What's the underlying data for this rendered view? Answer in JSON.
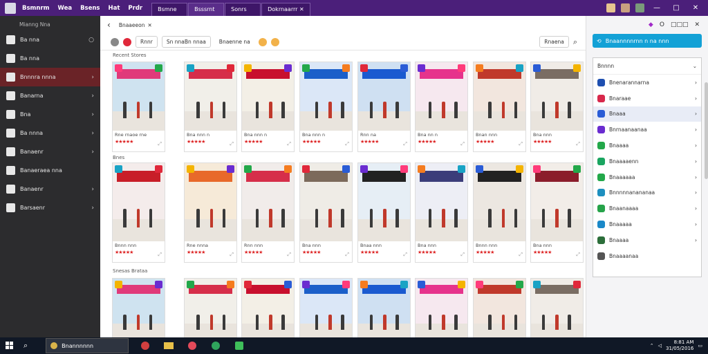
{
  "titlebar": {
    "menu": [
      "Bsmnrm",
      "Wea",
      "Bsens",
      "Hat",
      "Prdr"
    ],
    "tabs": [
      "Bsmne",
      "Bsssrnt",
      "Sonrs",
      "Dokrnaarrr ✕"
    ],
    "window_controls": {
      "minimize": "—",
      "maximize": "□",
      "close": "✕"
    }
  },
  "sidebar": {
    "header": "Mianng Nna",
    "items": [
      {
        "label": "Ba nna",
        "trail": "○",
        "icon": "folder-icon"
      },
      {
        "label": "Ba nna",
        "trail": "",
        "icon": "grid-icon"
      },
      {
        "label": "Bnnnra nnna",
        "trail": "›",
        "icon": "store-icon",
        "active": true
      },
      {
        "label": "Banarna",
        "trail": "›",
        "icon": "home-icon"
      },
      {
        "label": "Bna",
        "trail": "›",
        "icon": "document-icon"
      },
      {
        "label": "Ba nnna",
        "trail": "›",
        "icon": "gallery-icon"
      },
      {
        "label": "Banaenr",
        "trail": "›",
        "icon": "image-icon"
      },
      {
        "label": "Banaeraea nna",
        "trail": "",
        "icon": "settings-icon"
      },
      {
        "label": "Banaenr",
        "trail": "›",
        "icon": "chart-icon"
      },
      {
        "label": "Barsaenr",
        "trail": "›",
        "icon": "user-icon"
      }
    ]
  },
  "toolbar": {
    "back": "‹",
    "crumb": "Bnaaeeon",
    "close": "✕",
    "right_icons": [
      "◆",
      "O",
      "□□□",
      "✕"
    ]
  },
  "filters": {
    "chip1": "Rnnr",
    "chip2": "Sn nnaBn nnaa",
    "chip3": "Bnaenne na",
    "action_button": "Rnaena",
    "search_icon": "search-icon"
  },
  "sections": [
    "Recent Stores",
    "Bnes",
    "Snesas Brataa"
  ],
  "cards": [
    {
      "caption": "Rne rnaoe rne",
      "stars": "★★★★★"
    },
    {
      "caption": "Bna nnn n",
      "stars": "★★★★★"
    },
    {
      "caption": "Bna nnn n",
      "stars": "★★★★★"
    },
    {
      "caption": "Bna nnn n",
      "stars": "★★★★★"
    },
    {
      "caption": "Rnn na",
      "stars": "★★★★★"
    },
    {
      "caption": "Bna nn n",
      "stars": "★★★★★"
    },
    {
      "caption": "Bnan nnn",
      "stars": "★★★★★"
    },
    {
      "caption": "Bna nnn",
      "stars": "★★★★★"
    },
    {
      "caption": "Bnnn nnn",
      "stars": "★★★★★"
    },
    {
      "caption": "Rne nnna",
      "stars": "★★★★★"
    },
    {
      "caption": "Rnn nnn",
      "stars": "★★★★★"
    },
    {
      "caption": "Bna nnn",
      "stars": "★★★★★"
    },
    {
      "caption": "Bnaa nnn",
      "stars": "★★★★★"
    },
    {
      "caption": "Bna nnn",
      "stars": "★★★★★"
    },
    {
      "caption": "Bnnn nnn",
      "stars": "★★★★★"
    },
    {
      "caption": "Bna nnn",
      "stars": "★★★★★"
    }
  ],
  "right_panel": {
    "button": "Bnaannnnrnn n na nnn",
    "list_header": "Bnnnn",
    "items": [
      {
        "label": "Bnenarannarna",
        "trail": "›",
        "color": "#1e4fb0"
      },
      {
        "label": "Bnaraae",
        "trail": "›",
        "color": "#d8284b"
      },
      {
        "label": "Bnaaa",
        "trail": "›",
        "color": "#2a5cd6",
        "active": true
      },
      {
        "label": "Bnrnaanaanaa",
        "trail": "›",
        "color": "#6a2cd0"
      },
      {
        "label": "Bnaaaa",
        "trail": "›",
        "color": "#23a84a"
      },
      {
        "label": "Bnaaaaenn",
        "trail": "›",
        "color": "#1aa560"
      },
      {
        "label": "Bnaaaaaa",
        "trail": "›",
        "color": "#23a84a"
      },
      {
        "label": "Bnnnnnanananaa",
        "trail": "›",
        "color": "#1d8fbf"
      },
      {
        "label": "Bnaanaaaa",
        "trail": "›",
        "color": "#26a34a"
      },
      {
        "label": "Bnaaaaa",
        "trail": "›",
        "color": "#1a88c8"
      },
      {
        "label": "Bnaaaa",
        "trail": "›",
        "color": "#2c6e3a"
      },
      {
        "label": "Bnaaaanaa",
        "trail": "",
        "color": "#555555"
      }
    ]
  },
  "taskbar": {
    "search_text": "Bnannnnnn",
    "tray_time": "8:81 AM",
    "tray_date": "31/05/2016"
  }
}
